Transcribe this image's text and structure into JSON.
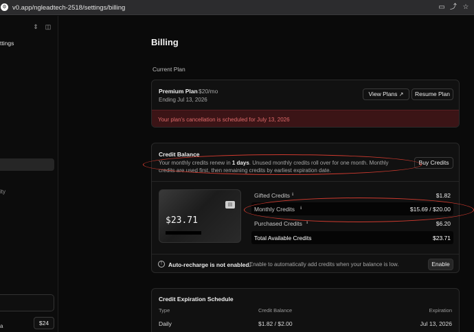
{
  "browser": {
    "url": "v0.app/ngleadtech-2518/settings/billing"
  },
  "sidebar": {
    "title_fragment": "ttings",
    "item_fragment": "ity",
    "footer_fragment": "a",
    "credit_badge": "$24"
  },
  "page": {
    "title": "Billing",
    "current_plan_label": "Current Plan"
  },
  "plan": {
    "name": "Premium Plan",
    "price": "$20/mo",
    "ending": "Ending Jul 13, 2026",
    "view_plans": "View Plans",
    "resume_plan": "Resume Plan",
    "cancellation_notice": "Your plan's cancellation is scheduled for July 13, 2026"
  },
  "credit_balance": {
    "title": "Credit Balance",
    "desc_part1": "Your monthly credits renew in ",
    "desc_bold": "1 days",
    "desc_part2": ". Unused monthly credits roll over for one month. Monthly credits are used first, then remaining credits by earliest expiration date.",
    "buy_credits": "Buy Credits",
    "card_amount": "$23.71",
    "rows": [
      {
        "label": "Gifted Credits",
        "value": "$1.82"
      },
      {
        "label": "Monthly Credits",
        "value": "$15.69 / $20.00"
      },
      {
        "label": "Purchased Credits",
        "value": "$6.20"
      },
      {
        "label": "Total Available Credits",
        "value": "$23.71"
      }
    ],
    "auto_recharge_title": "Auto-recharge is not enabled.",
    "auto_recharge_desc": "Enable to automatically add credits when your balance is low.",
    "enable": "Enable"
  },
  "expiration": {
    "title": "Credit Expiration Schedule",
    "headers": [
      "Type",
      "Credit Balance",
      "Expiration"
    ],
    "rows": [
      {
        "type": "Daily",
        "balance": "$1.82 / $2.00",
        "expiration": "Jul 13, 2026"
      }
    ]
  },
  "colors": {
    "background": "#0a0a0a",
    "card": "#111111",
    "cancel_banner": "#3b1416",
    "cancel_text": "#e06a6a",
    "annotation": "#d23b2f"
  }
}
